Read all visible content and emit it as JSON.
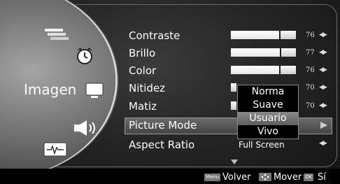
{
  "sidebar": {
    "category_label": "Imagen",
    "icons": [
      "source-icon",
      "alarm-clock-icon",
      "picture-icon",
      "speaker-icon",
      "signal-icon"
    ]
  },
  "menu": {
    "rows": [
      {
        "label": "Contraste",
        "value": "76",
        "level": 76
      },
      {
        "label": "Brillo",
        "value": "77",
        "level": 77
      },
      {
        "label": "Color",
        "value": "76",
        "level": 76
      },
      {
        "label": "Nitidez",
        "value": "70",
        "level": 70
      },
      {
        "label": "Matiz",
        "value": "70",
        "level": 70
      },
      {
        "label": "Picture Mode"
      },
      {
        "label": "Aspect Ratio",
        "value": "Full Screen"
      }
    ],
    "arrows": "◀▶"
  },
  "dropdown": {
    "options": [
      "Norma",
      "Suave",
      "Usuario",
      "Vivo"
    ],
    "selected": "Usuario"
  },
  "footer": {
    "menu_key": "Menu",
    "back": "Volver",
    "move": "Mover",
    "ok_key": "OK",
    "confirm": "Sí"
  }
}
